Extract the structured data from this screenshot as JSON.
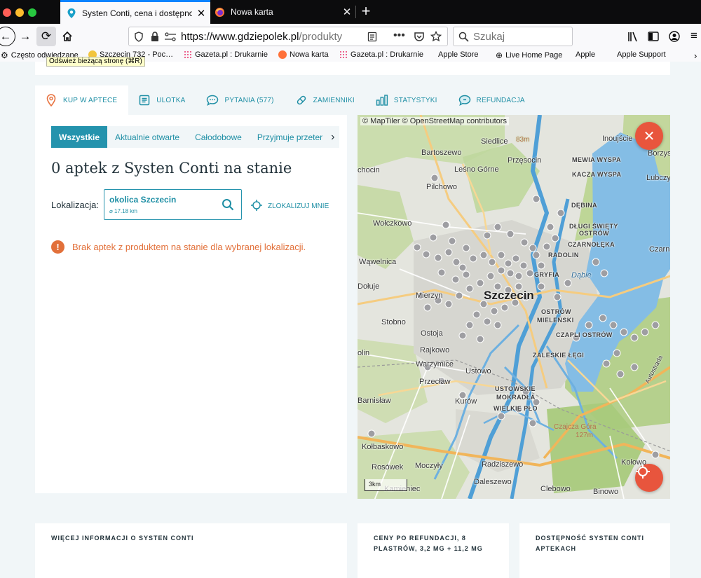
{
  "browser": {
    "tabs": [
      {
        "title": "Systen Conti, cena i dostępność",
        "active": true
      },
      {
        "title": "Nowa karta",
        "active": false
      }
    ],
    "url": {
      "host": "https://www.gdziepolek.pl",
      "rest": "/produkty"
    },
    "search_placeholder": "Szukaj",
    "tooltip": "Odśwież bieżącą stronę (⌘R)",
    "bookmarks": [
      "Często odwiedzane",
      "Szczecin 732 - Poc…",
      "Gazeta.pl : Drukarnie",
      "Nowa karta",
      "Gazeta.pl : Drukarnie",
      "Apple Store",
      "Live Home Page",
      "Apple",
      "Apple Support"
    ],
    "bookmarks_overflow": "›"
  },
  "product_tabs": [
    {
      "label": "KUP W APTECE",
      "icon": "pin-icon",
      "active": true
    },
    {
      "label": "ULOTKA",
      "icon": "leaflet-icon",
      "active": false
    },
    {
      "label": "PYTANIA (577)",
      "icon": "chat-icon",
      "active": false
    },
    {
      "label": "ZAMIENNIKI",
      "icon": "pill-icon",
      "active": false
    },
    {
      "label": "STATYSTYKI",
      "icon": "bar-chart-icon",
      "active": false
    },
    {
      "label": "REFUNDACJA",
      "icon": "refund-icon",
      "active": false
    }
  ],
  "filters": [
    {
      "label": "Wszystkie",
      "active": true
    },
    {
      "label": "Aktualnie otwarte",
      "active": false
    },
    {
      "label": "Całodobowe",
      "active": false
    },
    {
      "label": "Przyjmuje przeter",
      "active": false
    }
  ],
  "filters_next": "›",
  "heading": "0 aptek z Systen Conti na stanie",
  "location": {
    "label": "Lokalizacja:",
    "value": "okolica Szczecin",
    "distance": "⌀ 17.18 km",
    "locate_label": "ZLOKALIZUJ MNIE"
  },
  "alert": {
    "icon_text": "!",
    "message": "Brak aptek z produktem na stanie dla wybranej lokalizacji."
  },
  "map": {
    "attribution": "© MapTiler © OpenStreetMap contributors",
    "scale": "3km",
    "close_symbol": "✕",
    "labels": [
      "Siedlice",
      "83m",
      "Inoujście",
      "Bartoszewo",
      "Przęsocin",
      "MEWIA WYSPA",
      "Borzys",
      "chocin",
      "Leśno Górne",
      "KACZA WYSPA",
      "Lubczy",
      "Pilchowo",
      "DĘBINA",
      "Wołczkowo",
      "DŁUGI ŚWIĘTY",
      "OSTRÓW",
      "CZARNOŁĘKA",
      "Czarna",
      "RADOLIN",
      "Wąwelnica",
      "GRYFIA",
      "Dąbie",
      "Dołuje",
      "Mierzyn",
      "Szczecin",
      "OSTRÓW",
      "MIELEŃSKI",
      "Stobno",
      "CZAPLI OSTRÓW",
      "Ostoja",
      "Rajkowo",
      "ZALESKIE ŁĘGI",
      "olin",
      "Warzymice",
      "Ustowo",
      "Przecław",
      "USTOWSKIE",
      "MOKRADŁA",
      "WIELKIE PŁO",
      "Barnisław",
      "Kurów",
      "Czajcza Góra",
      "127m",
      "Kołbaskowo",
      "Rosówek",
      "Moczyły",
      "Radziszewo",
      "Kołowo",
      "Kamieniec",
      "Daleszewo",
      "Clebowo",
      "Binowo",
      "Autostrada"
    ]
  },
  "cards": [
    {
      "title": "WIĘCEJ INFORMACJI O SYSTEN CONTI"
    },
    {
      "title": "CENY PO REFUNDACJI, 8 PLASTRÓW, 3,2 MG + 11,2 MG"
    },
    {
      "title": "DOSTĘPNOŚĆ SYSTEN CONTI APTEKACH"
    }
  ]
}
